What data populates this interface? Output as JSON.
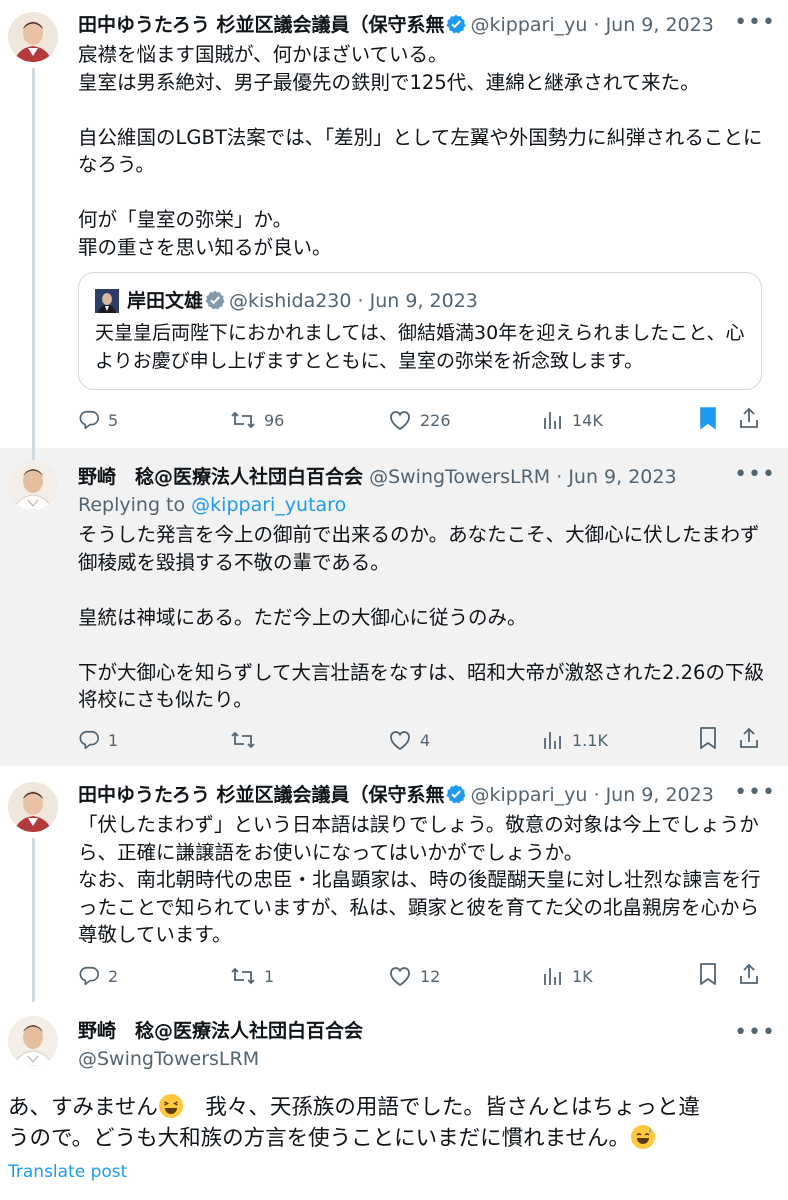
{
  "tweets": [
    {
      "name": "田中ゆうたろう 杉並区議会議員（保守系無",
      "handle": "@kippari_yu",
      "date": "Jun 9, 2023",
      "body": "宸襟を悩ます国賊が、何かほざいている。\n皇室は男系絶対、男子最優先の鉄則で125代、連綿と継承されて来た。\n\n自公維国のLGBT法案では、「差別」として左翼や外国勢力に糾弾されることになろう。\n\n何が「皇室の弥栄」か。\n罪の重さを思い知るが良い。",
      "quote": {
        "name": "岸田文雄",
        "handle": "@kishida230",
        "date": "Jun 9, 2023",
        "body": "天皇皇后両陛下におかれましては、御結婚満30年を迎えられましたこと、心よりお慶び申し上げますとともに、皇室の弥栄を祈念致します。"
      },
      "replies": "5",
      "retweets": "96",
      "likes": "226",
      "views": "14K"
    },
    {
      "name": "野崎　稔@医療法人社団白百合会",
      "handle": "@SwingTowersLRM",
      "date": "Jun 9, 2023",
      "replying_label": "Replying to",
      "replying_to": "@kippari_yutaro",
      "body": "そうした発言を今上の御前で出来るのか。あなたこそ、大御心に伏したまわず御稜威を毀損する不敬の輩である。\n\n皇統は神域にある。ただ今上の大御心に従うのみ。\n\n下が大御心を知らずして大言壮語をなすは、昭和大帝が激怒された2.26の下級将校にさも似たり。",
      "replies": "1",
      "retweets": "",
      "likes": "4",
      "views": "1.1K"
    },
    {
      "name": "田中ゆうたろう 杉並区議会議員（保守系無",
      "handle": "@kippari_yu",
      "date": "Jun 9, 2023",
      "body": "「伏したまわず」という日本語は誤りでしょう。敬意の対象は今上でしょうから、正確に謙譲語をお使いになってはいかがでしょうか。\nなお、南北朝時代の忠臣・北畠顕家は、時の後醍醐天皇に対し壮烈な諫言を行ったことで知られていますが、私は、顕家と彼を育てた父の北畠親房を心から尊敬しています。",
      "replies": "2",
      "retweets": "1",
      "likes": "12",
      "views": "1K"
    }
  ],
  "main_tweet": {
    "name": "野崎　稔@医療法人社団白百合会",
    "handle": "@SwingTowersLRM",
    "body_line1_a": "あ、すみません",
    "body_line1_b": "　我々、天孫族の用語でした。皆さんとはちょっと違",
    "body_line2": "うので。どうも大和族の方言を使うことにいまだに慣れません。",
    "translate": "Translate post"
  },
  "separator": "·"
}
